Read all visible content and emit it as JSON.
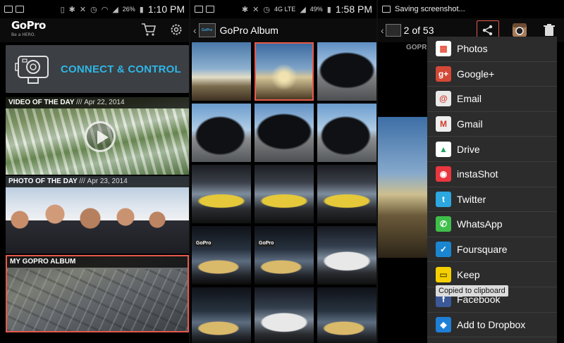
{
  "screen1": {
    "status": {
      "battery": "26%",
      "time": "1:10 PM"
    },
    "logo": {
      "main": "GoPro",
      "sub": "Be a HERO."
    },
    "connect_label": "CONNECT & CONTROL",
    "video_of_day": {
      "title": "VIDEO OF THE DAY",
      "sep": "///",
      "date": "Apr 22, 2014"
    },
    "photo_of_day": {
      "title": "PHOTO OF THE DAY",
      "sep": "///",
      "date": "Apr 23, 2014"
    },
    "my_album": {
      "title": "MY GOPRO ALBUM"
    }
  },
  "screen2": {
    "status": {
      "network": "4G LTE",
      "battery": "49%",
      "time": "1:58 PM"
    },
    "album_icon_text": "GoPro",
    "album_title": "GoPro Album",
    "thumb_sign": "GoPro"
  },
  "screen3": {
    "status": {
      "notification": "Saving screenshot..."
    },
    "counter": "2 of 53",
    "preview_label": "GOPR",
    "toast": "Copied to clipboard",
    "share_menu": [
      {
        "label": "Photos",
        "icon": "photos-icon",
        "color": "#ffffff"
      },
      {
        "label": "Google+",
        "icon": "google-plus-icon",
        "color": "#d34836"
      },
      {
        "label": "Email",
        "icon": "email-icon",
        "color": "#e9e9e9"
      },
      {
        "label": "Gmail",
        "icon": "gmail-icon",
        "color": "#eeeeee"
      },
      {
        "label": "Drive",
        "icon": "drive-icon",
        "color": "#ffffff"
      },
      {
        "label": "instaShot",
        "icon": "instashot-icon",
        "color": "#e8373f"
      },
      {
        "label": "Twitter",
        "icon": "twitter-icon",
        "color": "#2ca7e0"
      },
      {
        "label": "WhatsApp",
        "icon": "whatsapp-icon",
        "color": "#3fbf4a"
      },
      {
        "label": "Foursquare",
        "icon": "foursquare-icon",
        "color": "#1a86d0"
      },
      {
        "label": "Keep",
        "icon": "keep-icon",
        "color": "#f5d000"
      },
      {
        "label": "Facebook",
        "icon": "facebook-icon",
        "color": "#3b5998"
      },
      {
        "label": "Add to Dropbox",
        "icon": "dropbox-icon",
        "color": "#1f7fd6"
      }
    ]
  },
  "colors": {
    "accent_blue": "#2fb7e8",
    "selection_red": "#e65a4c"
  }
}
